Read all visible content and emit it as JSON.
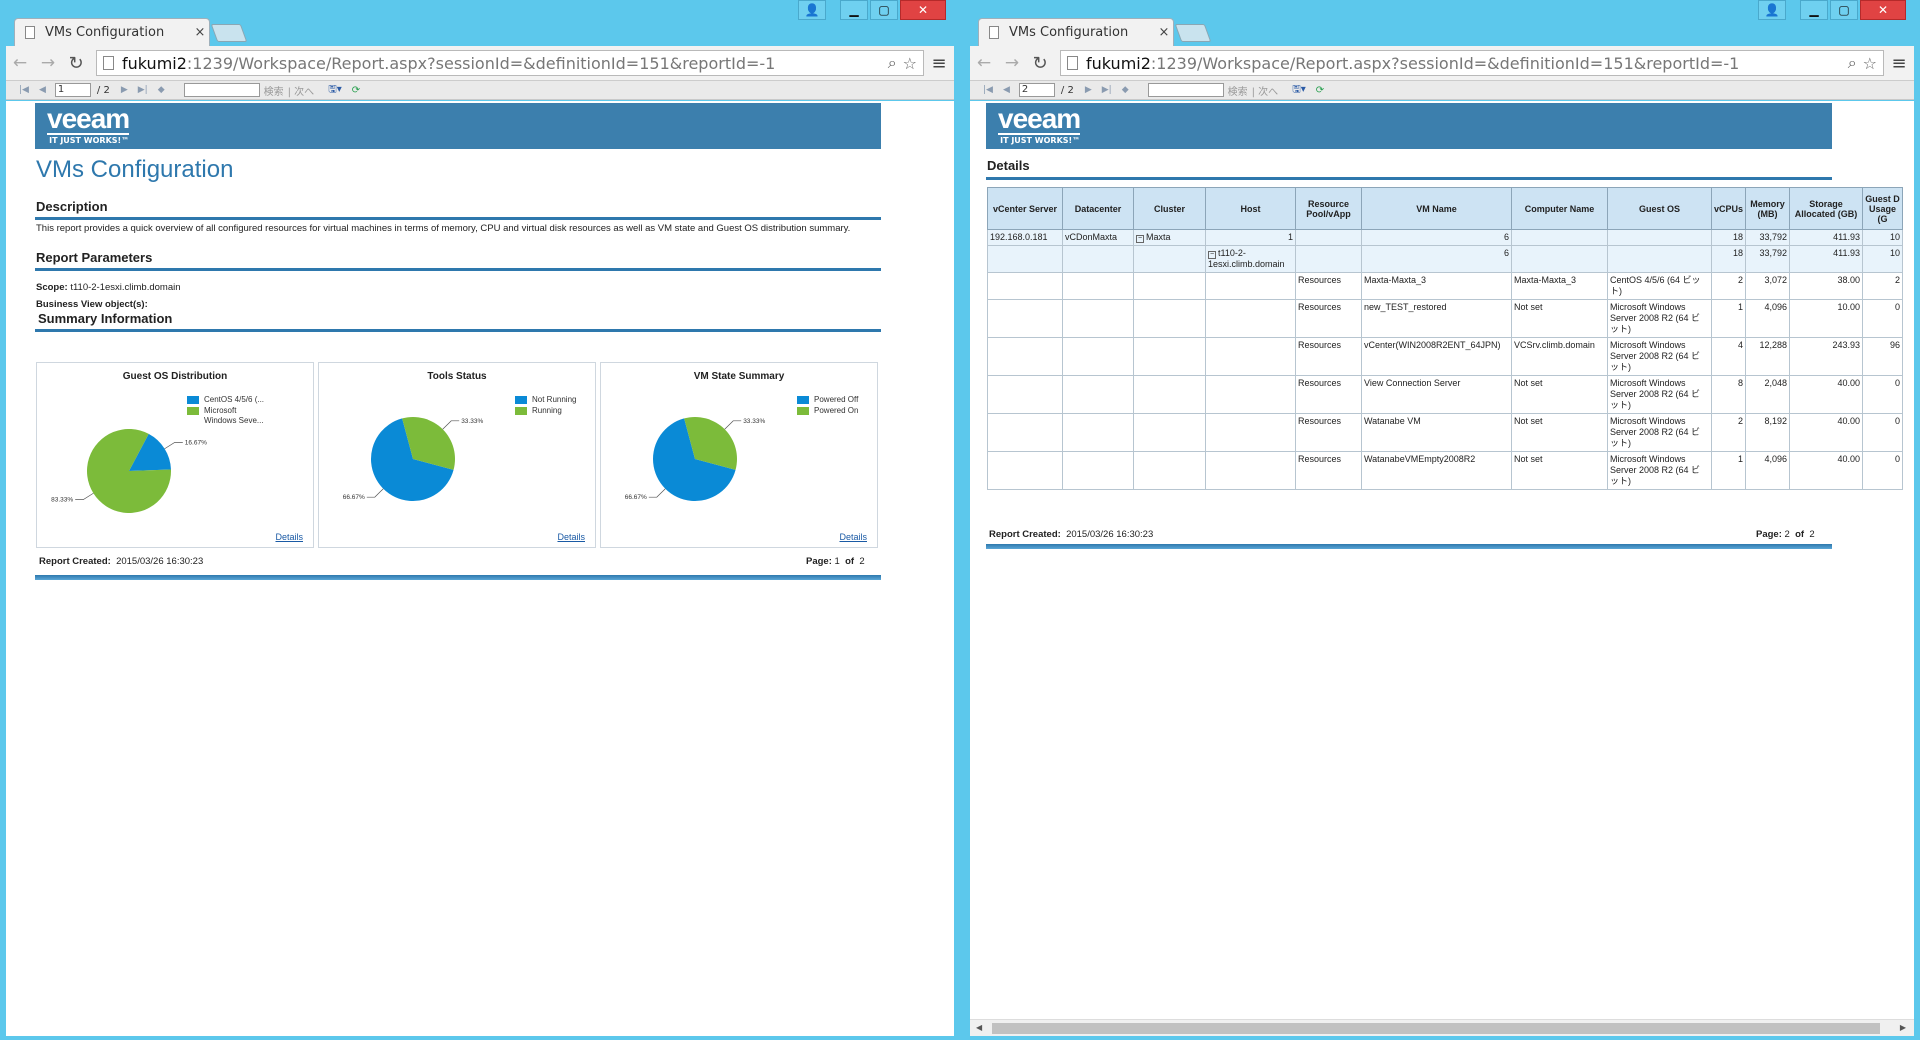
{
  "browser": {
    "tab_title": "VMs Configuration",
    "tab_close": "×",
    "url_host": "fukumi2",
    "url_rest": ":1239/Workspace/Report.aspx?sessionId=&definitionId=151&reportId=-1"
  },
  "left_report": {
    "page_input": "1",
    "page_total": "/ 2",
    "find_label": "検索",
    "next_label": "| 次へ",
    "banner_logo": "veeam",
    "banner_tagline": "IT JUST WORKS!™",
    "title": "VMs Configuration",
    "description_heading": "Description",
    "description_text": "This report provides a quick overview of all configured resources for virtual machines in terms of memory, CPU and virtual disk resources as well as VM state and Guest OS distribution summary.",
    "parameters_heading": "Report Parameters",
    "scope_label": "Scope:",
    "scope_value": "t110-2-1esxi.climb.domain",
    "bv_label": "Business View object(s):",
    "summary_heading": "Summary Information",
    "details_link": "Details",
    "footer_created_label": "Report Created:",
    "footer_created_value": "2015/03/26 16:30:23",
    "footer_page_label": "Page:",
    "footer_page_num": "1",
    "footer_of": "of",
    "footer_page_total": "2"
  },
  "right_report": {
    "page_input": "2",
    "page_total": "/ 2",
    "find_label": "検索",
    "next_label": "| 次へ",
    "details_heading": "Details",
    "columns": [
      "vCenter Server",
      "Datacenter",
      "Cluster",
      "Host",
      "Resource Pool/vApp",
      "VM Name",
      "Computer Name",
      "Guest OS",
      "vCPUs",
      "Memory (MB)",
      "Storage Allocated (GB)",
      "Guest D Usage (G"
    ],
    "rows": [
      {
        "vcenter": "192.168.0.181",
        "datacenter": "vCDonMaxta",
        "cluster": "Maxta",
        "host": "1",
        "pool": "",
        "vm": "6",
        "computer": "",
        "os": "",
        "vcpus": "18",
        "memory": "33,792",
        "storage": "411.93",
        "guest": "10"
      },
      {
        "vcenter": "",
        "datacenter": "",
        "cluster": "",
        "host": "t110-2-1esxi.climb.domain",
        "pool": "",
        "vm": "6",
        "computer": "",
        "os": "",
        "vcpus": "18",
        "memory": "33,792",
        "storage": "411.93",
        "guest": "10"
      },
      {
        "vcenter": "",
        "datacenter": "",
        "cluster": "",
        "host": "",
        "pool": "Resources",
        "vm": "Maxta-Maxta_3",
        "computer": "Maxta-Maxta_3",
        "os": "CentOS 4/5/6 (64 ビット)",
        "vcpus": "2",
        "memory": "3,072",
        "storage": "38.00",
        "guest": "2"
      },
      {
        "vcenter": "",
        "datacenter": "",
        "cluster": "",
        "host": "",
        "pool": "Resources",
        "vm": "new_TEST_restored",
        "computer": "Not set",
        "os": "Microsoft Windows Server 2008 R2 (64 ビット)",
        "vcpus": "1",
        "memory": "4,096",
        "storage": "10.00",
        "guest": "0"
      },
      {
        "vcenter": "",
        "datacenter": "",
        "cluster": "",
        "host": "",
        "pool": "Resources",
        "vm": "vCenter(WIN2008R2ENT_64JPN)",
        "computer": "VCSrv.climb.domain",
        "os": "Microsoft Windows Server 2008 R2 (64 ビット)",
        "vcpus": "4",
        "memory": "12,288",
        "storage": "243.93",
        "guest": "96"
      },
      {
        "vcenter": "",
        "datacenter": "",
        "cluster": "",
        "host": "",
        "pool": "Resources",
        "vm": "View Connection Server",
        "computer": "Not set",
        "os": "Microsoft Windows Server 2008 R2 (64 ビット)",
        "vcpus": "8",
        "memory": "2,048",
        "storage": "40.00",
        "guest": "0"
      },
      {
        "vcenter": "",
        "datacenter": "",
        "cluster": "",
        "host": "",
        "pool": "Resources",
        "vm": "Watanabe VM",
        "computer": "Not set",
        "os": "Microsoft Windows Server 2008 R2 (64 ビット)",
        "vcpus": "2",
        "memory": "8,192",
        "storage": "40.00",
        "guest": "0"
      },
      {
        "vcenter": "",
        "datacenter": "",
        "cluster": "",
        "host": "",
        "pool": "Resources",
        "vm": "WatanabeVMEmpty2008R2",
        "computer": "Not set",
        "os": "Microsoft Windows Server 2008 R2 (64 ビット)",
        "vcpus": "1",
        "memory": "4,096",
        "storage": "40.00",
        "guest": "0"
      }
    ],
    "footer_created_label": "Report Created:",
    "footer_created_value": "2015/03/26 16:30:23",
    "footer_page_label": "Page:",
    "footer_page_num": "2",
    "footer_of": "of",
    "footer_page_total": "2"
  },
  "colors": {
    "blue": "#0a8ad6",
    "green": "#7cbb3a",
    "banner": "#3c7fad",
    "accent": "#2e78ad"
  },
  "chart_data": [
    {
      "type": "pie",
      "title": "Guest OS Distribution",
      "series": [
        {
          "name": "CentOS 4/5/6 (...",
          "value": 16.67,
          "color": "#0a8ad6"
        },
        {
          "name": "Microsoft Windows Seve...",
          "value": 83.33,
          "color": "#7cbb3a"
        }
      ],
      "labels": [
        "16.67%",
        "83.33%"
      ]
    },
    {
      "type": "pie",
      "title": "Tools Status",
      "series": [
        {
          "name": "Not Running",
          "value": 66.67,
          "color": "#0a8ad6"
        },
        {
          "name": "Running",
          "value": 33.33,
          "color": "#7cbb3a"
        }
      ],
      "labels": [
        "66.67%",
        "33.33%"
      ]
    },
    {
      "type": "pie",
      "title": "VM State Summary",
      "series": [
        {
          "name": "Powered Off",
          "value": 66.67,
          "color": "#0a8ad6"
        },
        {
          "name": "Powered On",
          "value": 33.33,
          "color": "#7cbb3a"
        }
      ],
      "labels": [
        "66.67%",
        "33.33%"
      ]
    }
  ]
}
